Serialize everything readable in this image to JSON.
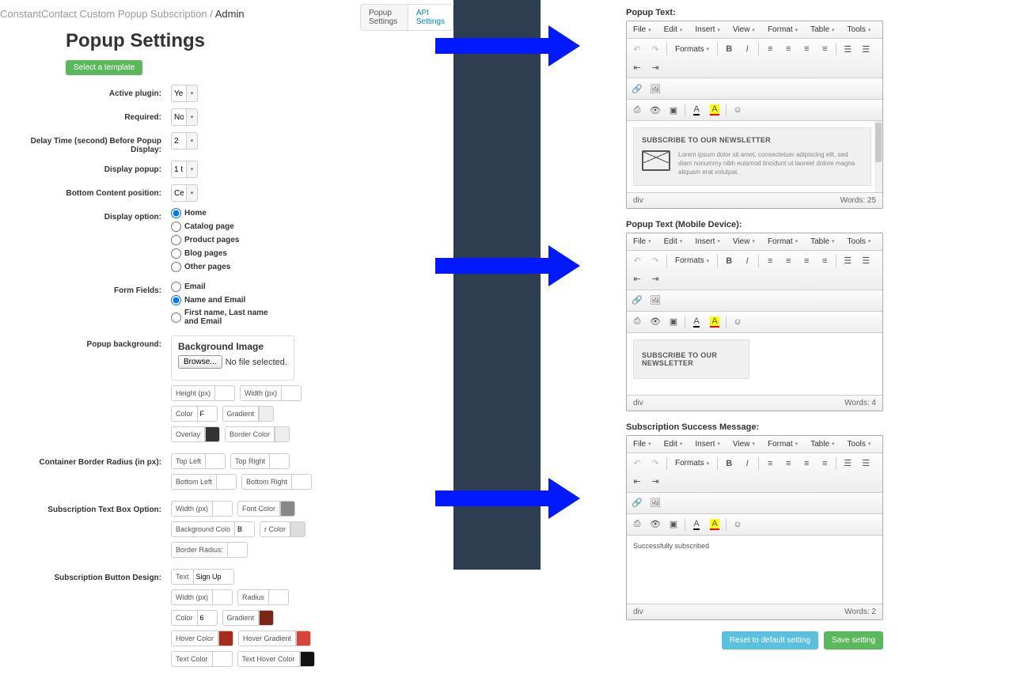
{
  "breadcrumb": {
    "path": "ConstantContact Custom Popup Subscription /",
    "active": "Admin"
  },
  "tabs": {
    "popup": "Popup Settings",
    "api": "API Settings"
  },
  "page_title": "Popup Settings",
  "select_template": "Select a template",
  "labels": {
    "active_plugin": "Active plugin:",
    "required": "Required:",
    "delay": "Delay Time (second) Before Popup Display:",
    "display_popup": "Display popup:",
    "bottom_content": "Bottom Content position:",
    "display_option": "Display option:",
    "form_fields": "Form Fields:",
    "popup_bg": "Popup background:",
    "border_radius": "Container Border Radius (in px):",
    "textbox_option": "Subscription Text Box Option:",
    "button_design": "Subscription Button Design:"
  },
  "values": {
    "active_plugin": "Ye",
    "required": "No",
    "delay": "2",
    "display_popup": "1 t",
    "bottom_content": "Ce"
  },
  "display_options": {
    "home": "Home",
    "catalog": "Catalog page",
    "product": "Product pages",
    "blog": "Blog pages",
    "other": "Other pages"
  },
  "form_fields": {
    "email": "Email",
    "name_email": "Name and Email",
    "full": "First name, Last name and Email"
  },
  "bg": {
    "title": "Background Image",
    "browse": "Browse...",
    "no_file": "No file selected.",
    "height": "Height (px)",
    "width": "Width (px)",
    "color": "Color",
    "color_val": "F",
    "gradient": "Gradient",
    "overlay": "Overlay",
    "border_color": "Border Color"
  },
  "radius": {
    "tl": "Top Left",
    "tr": "Top Right",
    "bl": "Bottom Left",
    "br": "Bottom Right"
  },
  "textbox": {
    "width": "Width (px)",
    "font_color": "Font Color",
    "bg_color": "Background Colo",
    "bg_val": "B",
    "border_color": "r Color",
    "border_radius": "Border Radius:"
  },
  "button": {
    "text": "Text",
    "text_val": "Sign Up",
    "width": "Width (px)",
    "radius": "Radius",
    "color": "Color",
    "color_val": "6",
    "gradient": "Gradient",
    "hover_color": "Hover Color",
    "hover_gradient": "Hover Gradient",
    "text_color": "Text Color",
    "text_hover_color": "Text Hover Color"
  },
  "editors": {
    "popup_text_label": "Popup Text:",
    "popup_mobile_label": "Popup Text (Mobile Device):",
    "success_label": "Subscription Success Message:",
    "menu": {
      "file": "File",
      "edit": "Edit",
      "insert": "Insert",
      "view": "View",
      "format": "Format",
      "table": "Table",
      "tools": "Tools"
    },
    "formats": "Formats",
    "newsletter_title": "SUBSCRIBE TO OUR NEWSLETTER",
    "newsletter_body": "Lorem ipsum dolor sit amet, consectetuer adipiscing elit, sed diam nonummy nibh euismod tincidunt ut laoreet dolore magna aliquam erat volutpat.",
    "success_text": "Successfully subscribed",
    "path": "div",
    "words1": "Words: 25",
    "words2": "Words: 4",
    "words3": "Words: 2"
  },
  "footer": {
    "reset": "Reset to default setting",
    "save": "Save setting"
  }
}
